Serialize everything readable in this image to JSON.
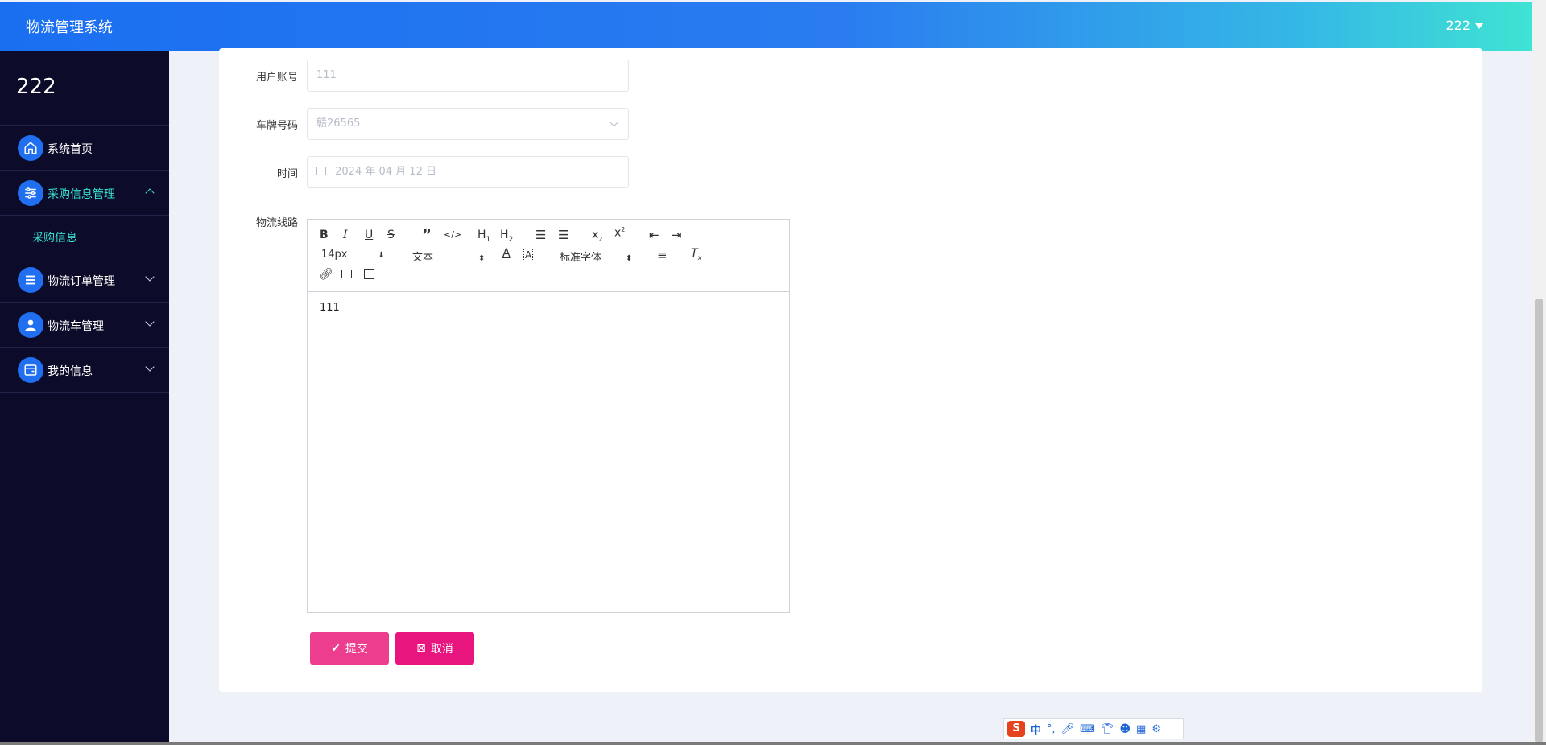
{
  "header": {
    "app_title": "物流管理系统",
    "username": "222"
  },
  "sidebar": {
    "brand": "222",
    "items": [
      {
        "label": "系统首页",
        "icon": "home-icon"
      },
      {
        "label": "采购信息管理",
        "icon": "sliders-icon",
        "expanded": true,
        "children": [
          {
            "label": "采购信息"
          }
        ]
      },
      {
        "label": "物流订单管理",
        "icon": "list-icon"
      },
      {
        "label": "物流车管理",
        "icon": "user-icon"
      },
      {
        "label": "我的信息",
        "icon": "card-icon"
      }
    ]
  },
  "form": {
    "account_label": "用户账号",
    "account_value": "111",
    "plate_label": "车牌号码",
    "plate_value": "赣26565",
    "time_label": "时间",
    "time_value": "2024 年 04 月 12 日",
    "route_label": "物流线路",
    "editor": {
      "font_size": "14px",
      "format": "文本",
      "font_family": "标准字体",
      "content": "111"
    },
    "submit_label": "提交",
    "cancel_label": "取消"
  },
  "colors": {
    "accent": "#1f6ff0",
    "active_text": "#39e0d0",
    "button_pink": "#ec2d8c",
    "sidebar_bg": "#0c0c2a"
  },
  "ime": {
    "label": "中"
  }
}
